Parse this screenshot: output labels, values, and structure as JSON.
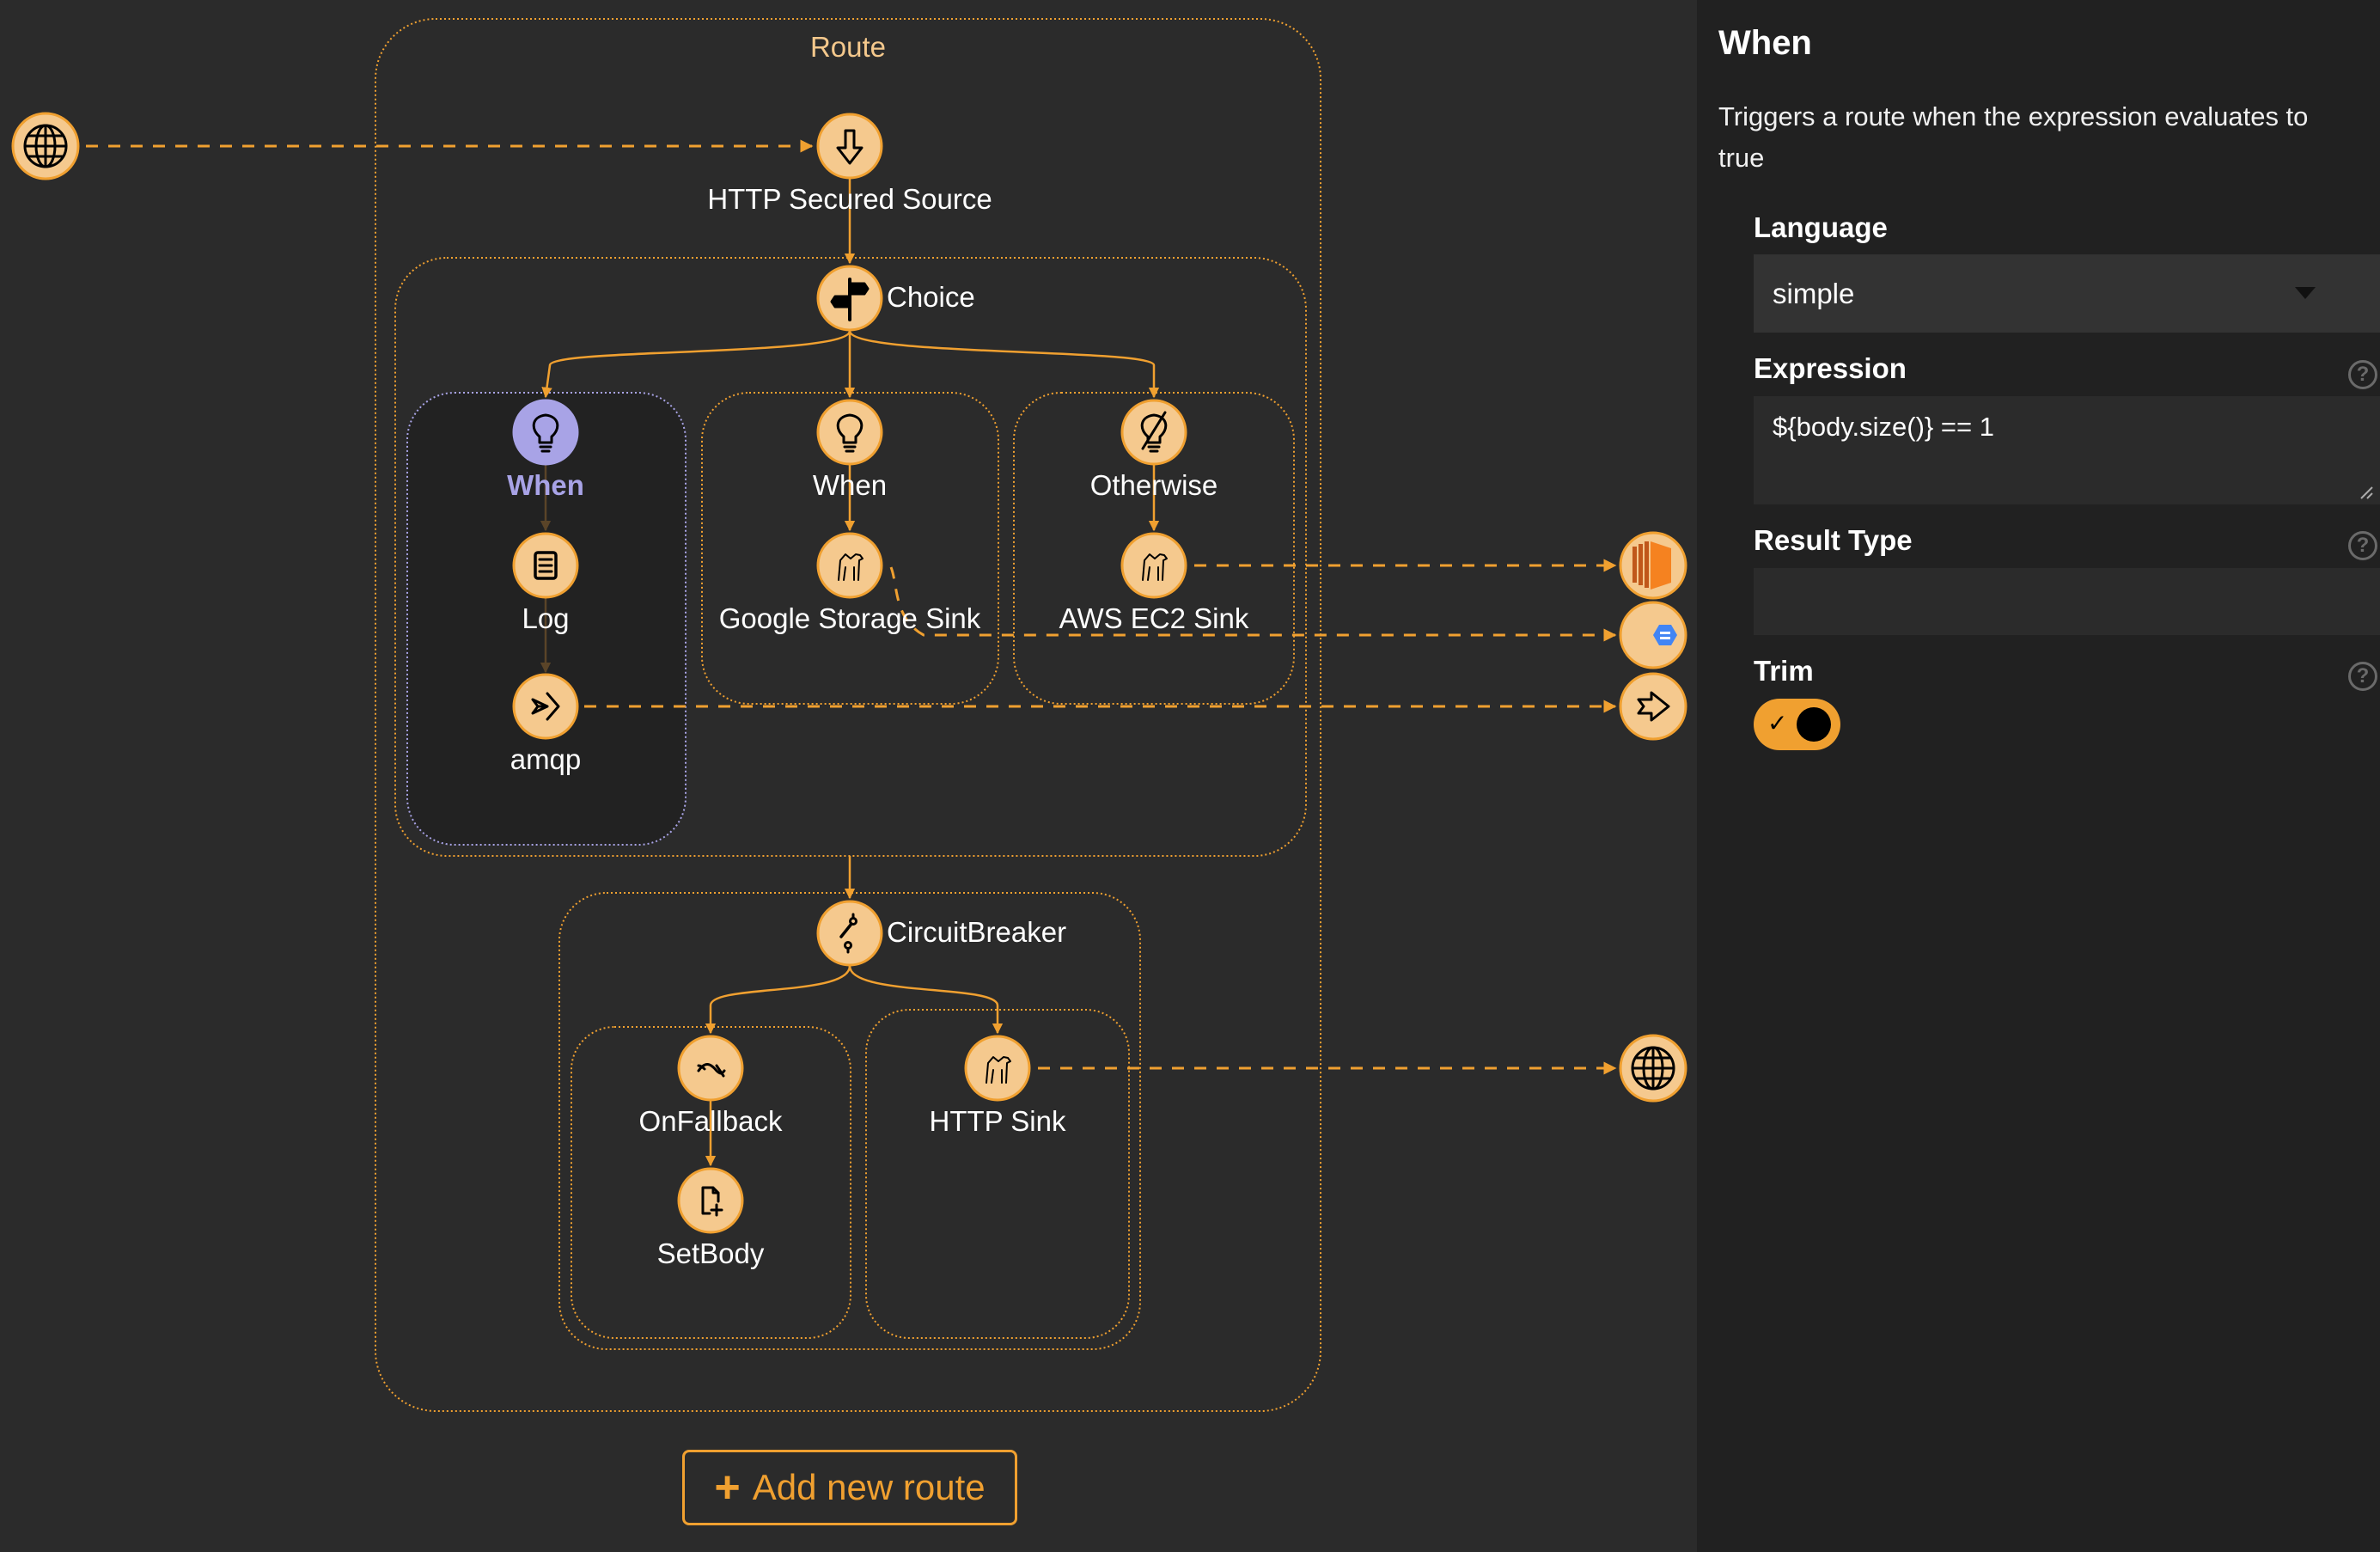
{
  "canvas": {
    "route_label": "Route",
    "colors": {
      "accent": "#f0a030",
      "node_fill": "#f5c98e",
      "selected": "#a8a3e6",
      "background": "#2b2b2b"
    },
    "nodes": {
      "http_secured_source": {
        "label": "HTTP Secured Source",
        "icon": "source-arrow-icon"
      },
      "choice": {
        "label": "Choice",
        "icon": "signpost-icon"
      },
      "when_1": {
        "label": "When",
        "icon": "lightbulb-icon",
        "selected": true
      },
      "log": {
        "label": "Log",
        "icon": "log-list-icon"
      },
      "amqp": {
        "label": "amqp",
        "icon": "send-arrow-icon"
      },
      "when_2": {
        "label": "When",
        "icon": "lightbulb-icon"
      },
      "google_storage_sink": {
        "label": "Google Storage Sink",
        "icon": "camel-icon"
      },
      "otherwise": {
        "label": "Otherwise",
        "icon": "lightbulb-off-icon"
      },
      "aws_ec2_sink": {
        "label": "AWS EC2 Sink",
        "icon": "camel-icon"
      },
      "circuit_breaker": {
        "label": "CircuitBreaker",
        "icon": "circuit-breaker-icon"
      },
      "on_fallback": {
        "label": "OnFallback",
        "icon": "fallback-icon"
      },
      "set_body": {
        "label": "SetBody",
        "icon": "file-add-icon"
      },
      "http_sink": {
        "label": "HTTP Sink",
        "icon": "camel-icon"
      }
    },
    "external": {
      "source_globe": {
        "icon": "globe-icon"
      },
      "aws_ec2": {
        "icon": "aws-ec2-icon"
      },
      "google_storage": {
        "icon": "google-storage-icon"
      },
      "amqp_target": {
        "icon": "send-arrow-icon"
      },
      "http_globe": {
        "icon": "globe-icon"
      }
    },
    "add_route_label": "Add new route"
  },
  "panel": {
    "title": "When",
    "description": "Triggers a route when the expression evaluates to true",
    "fields": {
      "language": {
        "label": "Language",
        "value": "simple"
      },
      "expression": {
        "label": "Expression",
        "value": "${body.size()} == 1"
      },
      "result_type": {
        "label": "Result Type",
        "value": ""
      },
      "trim": {
        "label": "Trim",
        "checked": true
      }
    },
    "help_glyph": "?"
  }
}
